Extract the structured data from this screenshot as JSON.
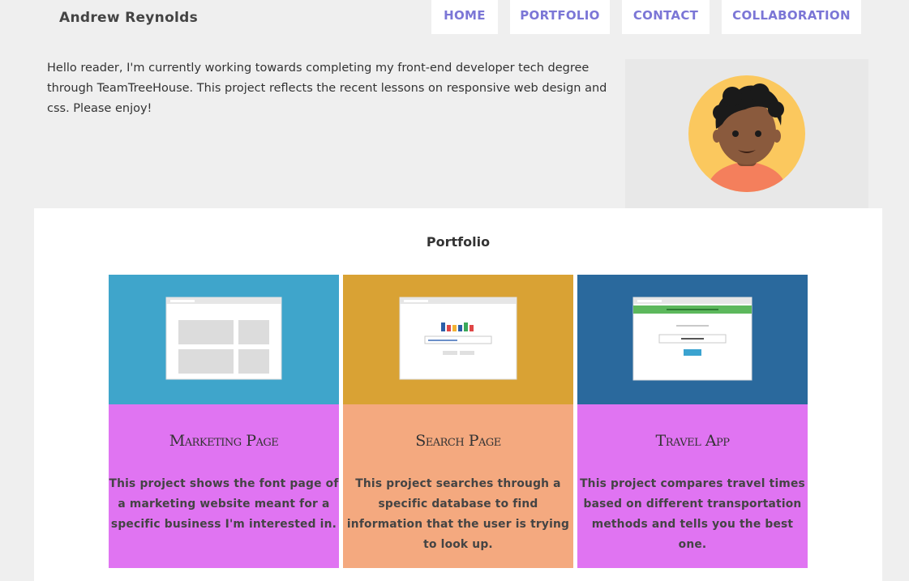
{
  "header": {
    "site_name": "Andrew Reynolds",
    "nav": [
      "HOME",
      "PORTFOLIO",
      "CONTACT",
      "COLLABORATION"
    ]
  },
  "intro": {
    "text": "Hello reader, I'm currently working towards completing my front-end developer tech degree through TeamTreeHouse. This project reflects the recent lessons on responsive web design and css. Please enjoy!"
  },
  "portfolio": {
    "title": "Portfolio",
    "projects": [
      {
        "title": "Marketing Page",
        "description": "This project shows the font page of a marketing website meant for a specific business I'm interested in.",
        "thumb_bg": "#3fa5cb",
        "body_bg": "#e074f2",
        "icon": "marketing-page-mockup-icon"
      },
      {
        "title": "Search Page",
        "description": "This project searches through a specific database to find information that the user is trying to look up.",
        "thumb_bg": "#d9a234",
        "body_bg": "#f4a97f",
        "icon": "search-page-mockup-icon"
      },
      {
        "title": "Travel App",
        "description": "This project compares travel times based on different transportation methods and tells you the best one.",
        "thumb_bg": "#2a699d",
        "body_bg": "#e074f2",
        "icon": "travel-app-mockup-icon"
      }
    ]
  },
  "colors": {
    "nav_text": "#7b76d6",
    "page_bg": "#efefef",
    "avatar_bg": "#fbc85e",
    "avatar_shirt": "#f47f5c",
    "avatar_skin": "#8a5a3d"
  }
}
